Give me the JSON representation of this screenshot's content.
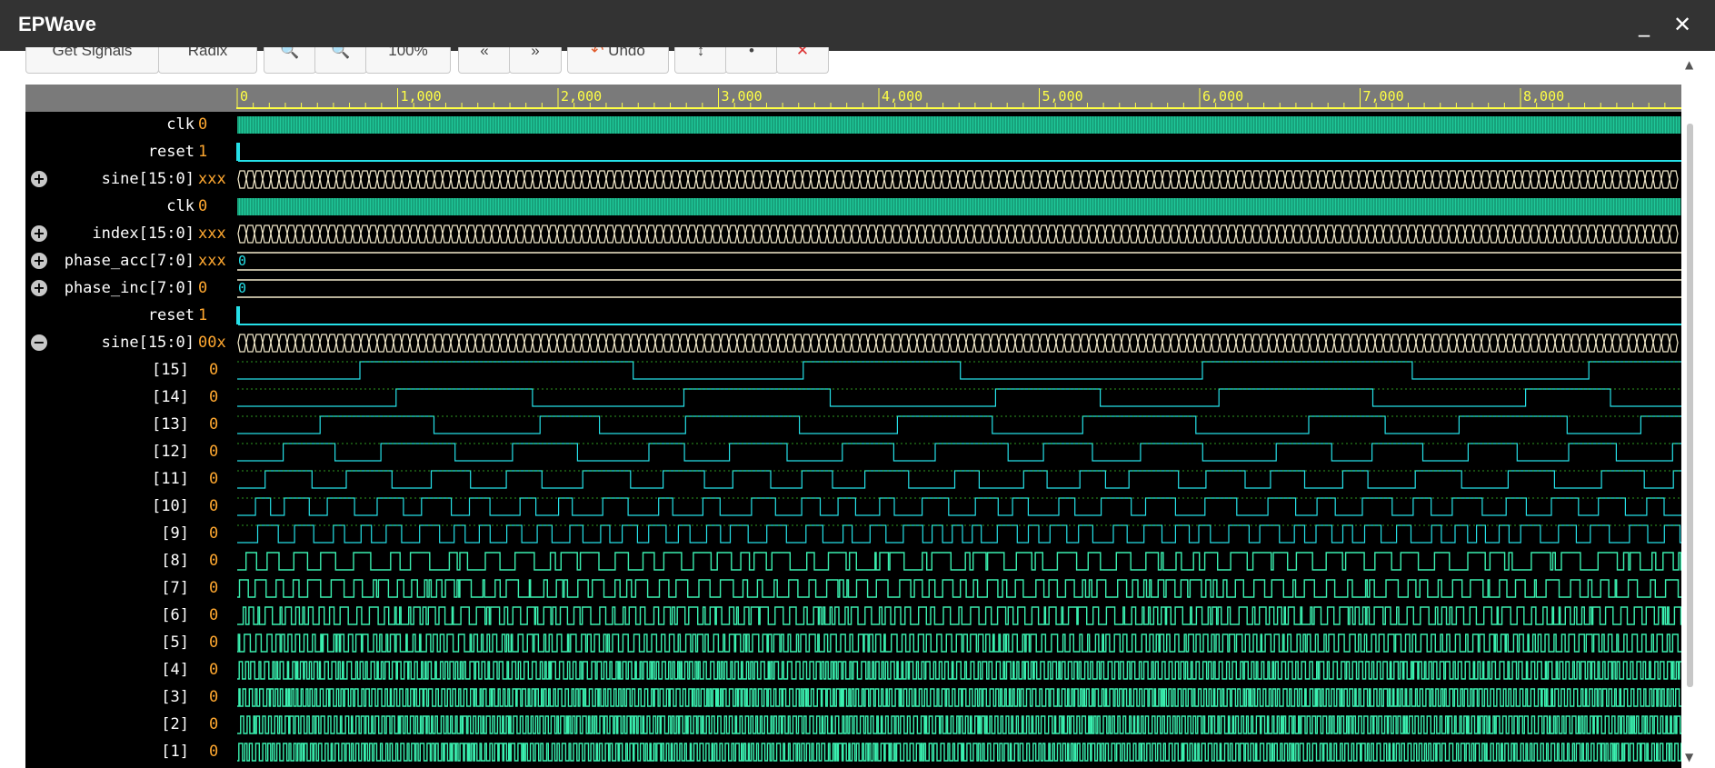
{
  "window": {
    "title": "EPWave",
    "minimize_glyph": "_",
    "close_glyph": "✕"
  },
  "toolbar": {
    "buttons": [
      {
        "label": "Get Signals",
        "icon": ""
      },
      {
        "label": "Radix",
        "icon": ""
      },
      {
        "label": "",
        "icon": "zoom-in-icon"
      },
      {
        "label": "",
        "icon": "zoom-out-icon"
      },
      {
        "label": "100%",
        "icon": ""
      },
      {
        "label": "",
        "icon": "back-icon"
      },
      {
        "label": "",
        "icon": "forward-icon"
      },
      {
        "label": "Undo",
        "icon": "undo-icon"
      },
      {
        "label": "",
        "icon": "mark-icon"
      },
      {
        "label": "",
        "icon": "info-icon"
      },
      {
        "label": "",
        "icon": "delete-icon"
      }
    ]
  },
  "ruler": {
    "ticks": [
      "0",
      "1,000",
      "2,000",
      "3,000",
      "4,000",
      "5,000",
      "6,000",
      "7,000",
      "8,000"
    ]
  },
  "signals": [
    {
      "name": "clk",
      "value": "0",
      "kind": "clock",
      "expander": ""
    },
    {
      "name": "reset",
      "value": "1",
      "kind": "reset",
      "expander": ""
    },
    {
      "name": "sine[15:0]",
      "value": "xxx",
      "kind": "busdense",
      "expander": "+"
    },
    {
      "name": "clk",
      "value": "0",
      "kind": "clock",
      "expander": ""
    },
    {
      "name": "index[15:0]",
      "value": "xxx",
      "kind": "busdense",
      "expander": "+"
    },
    {
      "name": "phase_acc[7:0]",
      "value": "xxx",
      "kind": "busconst",
      "expander": "+",
      "wave_label": "0"
    },
    {
      "name": "phase_inc[7:0]",
      "value": "0",
      "kind": "busconst",
      "expander": "+",
      "wave_label": "0"
    },
    {
      "name": "reset",
      "value": "1",
      "kind": "reset",
      "expander": ""
    },
    {
      "name": "sine[15:0]",
      "value": "00x",
      "kind": "busdense",
      "expander": "−"
    },
    {
      "name": "[15]",
      "value": "0",
      "kind": "bit",
      "expander": ""
    },
    {
      "name": "[14]",
      "value": "0",
      "kind": "bit",
      "expander": ""
    },
    {
      "name": "[13]",
      "value": "0",
      "kind": "bit",
      "expander": ""
    },
    {
      "name": "[12]",
      "value": "0",
      "kind": "bit",
      "expander": ""
    },
    {
      "name": "[11]",
      "value": "0",
      "kind": "bit",
      "expander": ""
    },
    {
      "name": "[10]",
      "value": "0",
      "kind": "bit",
      "expander": ""
    },
    {
      "name": "[9]",
      "value": "0",
      "kind": "bit",
      "expander": ""
    },
    {
      "name": "[8]",
      "value": "0",
      "kind": "bit",
      "expander": ""
    },
    {
      "name": "[7]",
      "value": "0",
      "kind": "bit",
      "expander": ""
    },
    {
      "name": "[6]",
      "value": "0",
      "kind": "bit",
      "expander": ""
    },
    {
      "name": "[5]",
      "value": "0",
      "kind": "bit",
      "expander": ""
    },
    {
      "name": "[4]",
      "value": "0",
      "kind": "bit",
      "expander": ""
    },
    {
      "name": "[3]",
      "value": "0",
      "kind": "bit",
      "expander": ""
    },
    {
      "name": "[2]",
      "value": "0",
      "kind": "bit",
      "expander": ""
    },
    {
      "name": "[1]",
      "value": "0",
      "kind": "bit",
      "expander": ""
    }
  ],
  "colors": {
    "wave_green": "#1fc99a",
    "wave_cyan": "#25e0e8",
    "wave_lime": "#4dff3a",
    "bus_line": "#f5eccd",
    "ruler_line": "#ffff44",
    "value_orange": "#ffa830"
  }
}
